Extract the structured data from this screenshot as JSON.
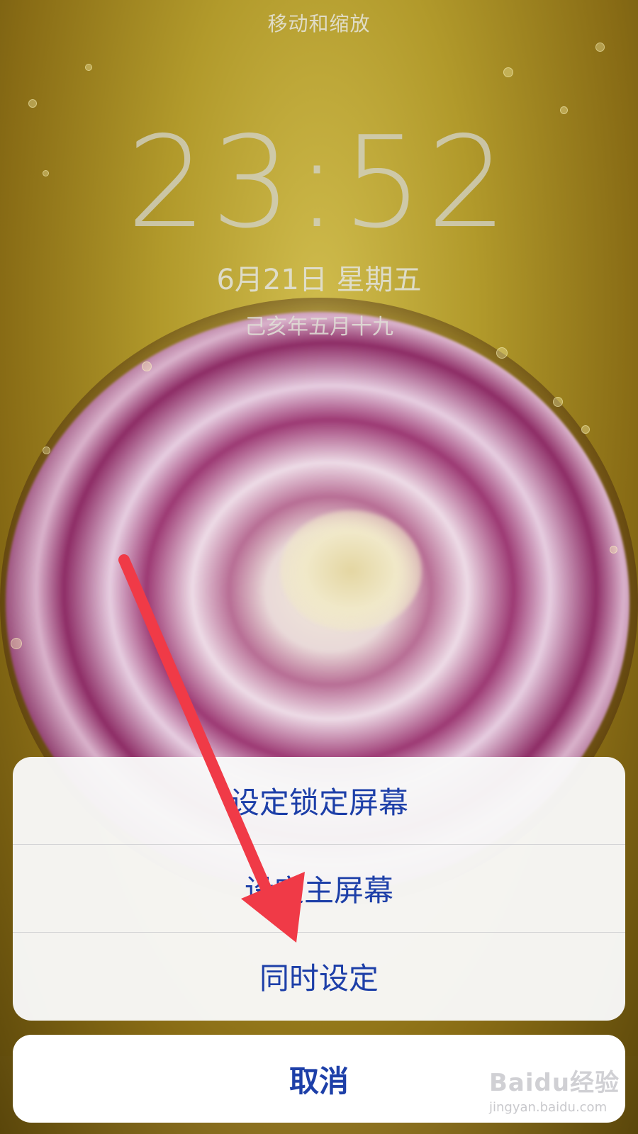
{
  "header": {
    "title": "移动和缩放"
  },
  "lockscreen": {
    "time": "23:52",
    "date": "6月21日 星期五",
    "lunar_date": "己亥年五月十九"
  },
  "action_sheet": {
    "items": [
      {
        "label": "设定锁定屏幕"
      },
      {
        "label": "设定主屏幕"
      },
      {
        "label": "同时设定"
      }
    ],
    "cancel_label": "取消"
  },
  "annotation": {
    "arrow_color": "#f03a47"
  },
  "watermark": {
    "brand": "Baidu经验",
    "site": "jingyan.baidu.com"
  },
  "colors": {
    "action_text": "#1d3fa8",
    "sheet_background": "#f8f8f8"
  }
}
